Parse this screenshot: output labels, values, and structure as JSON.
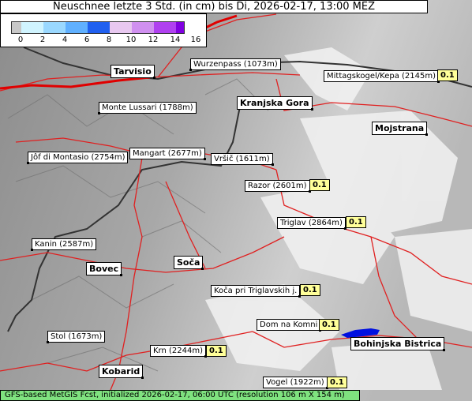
{
  "title": "Neuschnee letzte 3 Std. (in cm) bis Di, 2026-02-17, 13:00 MEZ",
  "legend": {
    "ticks": [
      "0",
      "2",
      "4",
      "6",
      "8",
      "10",
      "12",
      "14",
      "16"
    ],
    "colors": [
      "#c8c8c8",
      "#d0f4ff",
      "#9ad8ff",
      "#60b0ff",
      "#2060f0",
      "#e8c8f0",
      "#d090f0",
      "#b040f0",
      "#8000e0"
    ]
  },
  "places": [
    {
      "name": "Wurzenpass (1073m)"
    },
    {
      "name": "Mittagskogel/Kepa (2145m)",
      "value": "0.1"
    },
    {
      "name": "Tarvisio"
    },
    {
      "name": "Kranjska Gora"
    },
    {
      "name": "Monte Lussari (1788m)"
    },
    {
      "name": "Mojstrana"
    },
    {
      "name": "Jôf di Montasio (2754m)"
    },
    {
      "name": "Mangart (2677m)"
    },
    {
      "name": "Vršič (1611m)"
    },
    {
      "name": "Razor (2601m)",
      "value": "0.1"
    },
    {
      "name": "Triglav (2864m)",
      "value": "0.1"
    },
    {
      "name": "Kanin (2587m)"
    },
    {
      "name": "Soča"
    },
    {
      "name": "Bovec"
    },
    {
      "name": "Koča pri Triglavskih j.",
      "value": "0.1"
    },
    {
      "name": "Dom na Komni",
      "value": "0.1"
    },
    {
      "name": "Stol (1673m)"
    },
    {
      "name": "Bohinjska Bistrica"
    },
    {
      "name": "Krn (2244m)",
      "value": "0.1"
    },
    {
      "name": "Kobarid"
    },
    {
      "name": "Vogel (1922m)",
      "value": "0.1"
    }
  ],
  "footer": "GFS-based MetGIS Fcst, initialized 2026-02-17, 06:00 UTC  (resolution 106 m X 154 m)"
}
